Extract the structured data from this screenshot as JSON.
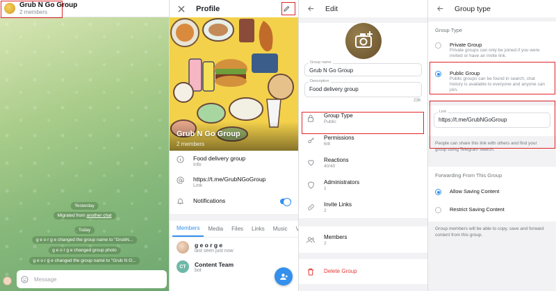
{
  "chat": {
    "title": "Grub N Go Group",
    "members": "2 members",
    "service": [
      "Yesterday",
      "Migrated from",
      "another chat",
      "Today",
      "g e o r g e  changed the group name to \"GrubN...",
      "g e o r g e  changed group photo",
      "g e o r g e  changed the group name to \"Grub N G..."
    ],
    "input_placeholder": "Message"
  },
  "profile": {
    "header_title": "Profile",
    "cover_title": "Grub N Go Group",
    "cover_sub": "2 members",
    "rows": [
      {
        "main": "Food delivery group",
        "sub": "Info"
      },
      {
        "main": "https://t.me/GrubNGoGroup",
        "sub": "Link"
      },
      {
        "main": "Notifications",
        "sub": ""
      }
    ],
    "tabs": [
      "Members",
      "Media",
      "Files",
      "Links",
      "Music",
      "Voice"
    ],
    "members": [
      {
        "name": "g e o r g e",
        "sub": "last seen just now",
        "initials": ""
      },
      {
        "name": "Content Team",
        "sub": "bot",
        "initials": "CT"
      }
    ]
  },
  "edit": {
    "header_title": "Edit",
    "name_label": "Group name",
    "name_value": "Grub N Go Group",
    "desc_label": "Description",
    "desc_value": "Food delivery group",
    "counter": "236",
    "rows": [
      {
        "main": "Group Type",
        "sub": "Public"
      },
      {
        "main": "Permissions",
        "sub": "6/8"
      },
      {
        "main": "Reactions",
        "sub": "40/40"
      },
      {
        "main": "Administrators",
        "sub": "1"
      },
      {
        "main": "Invite Links",
        "sub": "2"
      }
    ],
    "members_row": {
      "main": "Members",
      "sub": "2"
    },
    "delete_label": "Delete Group"
  },
  "group_type": {
    "header_title": "Group type",
    "section_label": "Group Type",
    "private_title": "Private Group",
    "private_desc": "Private groups can only be joined if you were invited or have an invite link.",
    "public_title": "Public Group",
    "public_desc": "Public groups can be found in search, chat history is available to everyone and anyone can join.",
    "link_label": "Link",
    "link_value": "https://t.me/GrubNGoGroup",
    "link_hint": "People can share this link with others and find your group using Telegram search.",
    "forward_section": "Forwarding From This Group",
    "allow_label": "Allow Saving Content",
    "restrict_label": "Restrict Saving Content",
    "forward_hint": "Group members will be able to copy, save and forward content from this group."
  },
  "colors": {
    "accent": "#3390ec",
    "highlight": "#e0242a",
    "danger": "#e53935"
  }
}
